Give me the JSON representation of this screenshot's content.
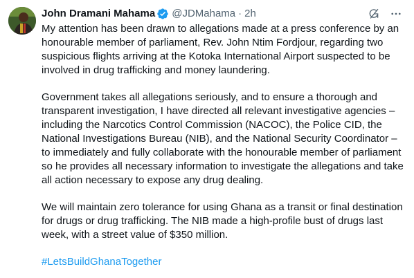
{
  "author": {
    "name": "John Dramani Mahama",
    "handle": "@JDMahama",
    "separator": "·",
    "time": "2h"
  },
  "icons": {
    "avatar": "profile-photo",
    "verified": "verified-badge-icon",
    "grok": "grok-icon",
    "more": "more-options-icon"
  },
  "colors": {
    "verified": "#1d9bf0",
    "hashtag": "#1d9bf0",
    "secondary_text": "#536471"
  },
  "body": {
    "p1": "My attention has been drawn to allegations made at a press conference by an honourable member of parliament, Rev. John Ntim Fordjour, regarding two suspicious flights arriving at the Kotoka International Airport suspected to be involved in drug trafficking and money laundering.",
    "p2": "Government takes all allegations seriously, and to ensure a thorough and transparent investigation, I have directed all relevant investigative agencies – including the Narcotics Control Commission (NACOC), the Police CID, the National Investigations Bureau (NIB), and the National Security Coordinator – to immediately and fully collaborate with the honourable member of parliament so he provides all necessary information to investigate the allegations and take all action necessary to expose any drug dealing.",
    "p3": "We will maintain zero tolerance for using Ghana as a transit or final destination for drugs or drug trafficking. The NIB made a high-profile bust of drugs last week, with a street value of $350 million.",
    "hashtag": "#LetsBuildGhanaTogether"
  }
}
